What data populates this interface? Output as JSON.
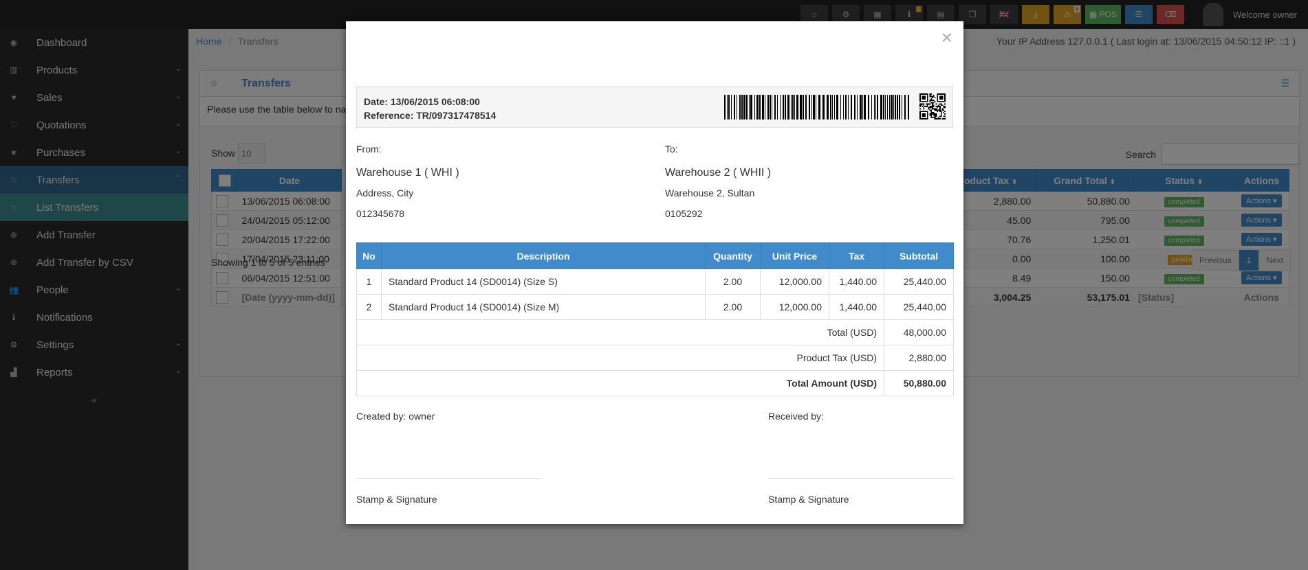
{
  "topbar": {
    "buttons": [
      {
        "name": "dashboard-icon",
        "glyph": "⌂",
        "style": "",
        "badge": ""
      },
      {
        "name": "settings-cogs-icon",
        "glyph": "⚙",
        "style": "",
        "badge": ""
      },
      {
        "name": "calculator-icon",
        "glyph": "▦",
        "style": "",
        "badge": ""
      },
      {
        "name": "info-icon",
        "glyph": "ℹ",
        "style": "",
        "badge": "1"
      },
      {
        "name": "calendar-icon",
        "glyph": "▤",
        "style": "",
        "badge": ""
      },
      {
        "name": "window-icon",
        "glyph": "❐",
        "style": "",
        "badge": ""
      },
      {
        "name": "uk-flag-icon",
        "glyph": "🇬🇧",
        "style": "",
        "badge": ""
      },
      {
        "name": "download-icon",
        "glyph": "⤓",
        "style": "y",
        "badge": ""
      },
      {
        "name": "warning-icon",
        "glyph": "⚠",
        "style": "y",
        "badge": "8"
      },
      {
        "name": "pos-button",
        "glyph": "▦ POS",
        "style": "g",
        "badge": ""
      },
      {
        "name": "list-icon",
        "glyph": "☰",
        "style": "b",
        "badge": ""
      },
      {
        "name": "eraser-icon",
        "glyph": "⌫",
        "style": "r",
        "badge": ""
      }
    ],
    "welcome": "Welcome owner"
  },
  "sidebar": {
    "items": [
      {
        "icon": "dashboard-icon",
        "glyph": "◉",
        "label": "Dashboard",
        "chev": "",
        "state": ""
      },
      {
        "icon": "barcode-icon",
        "glyph": "▥",
        "label": "Products",
        "chev": "⌄",
        "state": ""
      },
      {
        "icon": "heart-icon",
        "glyph": "♥",
        "label": "Sales",
        "chev": "⌄",
        "state": ""
      },
      {
        "icon": "heart-outline-icon",
        "glyph": "♡",
        "label": "Quotations",
        "chev": "⌄",
        "state": ""
      },
      {
        "icon": "star-icon",
        "glyph": "★",
        "label": "Purchases",
        "chev": "⌄",
        "state": ""
      },
      {
        "icon": "star-outline-icon",
        "glyph": "☆",
        "label": "Transfers",
        "chev": "⌃",
        "state": "active"
      },
      {
        "icon": "star-outline-icon",
        "glyph": "☆",
        "label": "List Transfers",
        "chev": "",
        "state": "sub"
      },
      {
        "icon": "plus-circle-icon",
        "glyph": "⊕",
        "label": "Add Transfer",
        "chev": "",
        "state": ""
      },
      {
        "icon": "plus-circle-icon",
        "glyph": "⊕",
        "label": "Add Transfer by CSV",
        "chev": "",
        "state": ""
      },
      {
        "icon": "users-icon",
        "glyph": "👥",
        "label": "People",
        "chev": "⌄",
        "state": ""
      },
      {
        "icon": "info-circle-icon",
        "glyph": "ℹ",
        "label": "Notifications",
        "chev": "",
        "state": ""
      },
      {
        "icon": "cog-icon",
        "glyph": "⚙",
        "label": "Settings",
        "chev": "⌄",
        "state": ""
      },
      {
        "icon": "bar-chart-icon",
        "glyph": "▟",
        "label": "Reports",
        "chev": "⌄",
        "state": ""
      }
    ],
    "collapse_glyph": "«"
  },
  "main": {
    "breadcrumb_home": "Home",
    "breadcrumb_sep": "/",
    "breadcrumb_current": "Transfers",
    "ip_info": "Your IP Address 127.0.0.1 ( Last login at: 13/06/2015 04:50:12 IP: ::1 )",
    "panel_title": "Transfers",
    "intro": "Please use the table below to na",
    "show_label": "Show",
    "show_value": "10",
    "search_label": "Search",
    "left_cols": {
      "date_header": "Date"
    },
    "left_rows": [
      "13/06/2015 06:08:00",
      "24/04/2015 05:12:00",
      "20/04/2015 17:22:00",
      "17/04/2015 23:11:00",
      "06/04/2015 12:51:00"
    ],
    "left_footer": "[Date (yyyy-mm-dd)]",
    "right_headers": {
      "product_tax": "oduct Tax",
      "grand_total": "Grand Total",
      "status": "Status",
      "actions": "Actions"
    },
    "right_rows": [
      {
        "tax": "2,880.00",
        "total": "50,880.00",
        "status": "completed"
      },
      {
        "tax": "45.00",
        "total": "795.00",
        "status": "completed"
      },
      {
        "tax": "70.76",
        "total": "1,250.01",
        "status": "completed"
      },
      {
        "tax": "0.00",
        "total": "100.00",
        "status": "pending"
      },
      {
        "tax": "8.49",
        "total": "150.00",
        "status": "completed"
      }
    ],
    "actions_label": "Actions ▾",
    "right_footer": {
      "tax": "3,004.25",
      "total": "53,175.01",
      "status": "[Status]",
      "actions": "Actions"
    },
    "showing": "Showing 1 to 5 of 5 entries",
    "pager": {
      "prev": "Previous",
      "page": "1",
      "next": "Next"
    }
  },
  "modal": {
    "close": "×",
    "date_line": "Date: 13/06/2015 06:08:00",
    "ref_line": "Reference: TR/097317478514",
    "from": {
      "label": "From:",
      "name": "Warehouse 1 ( WHI )",
      "address": "Address, City",
      "phone": "012345678"
    },
    "to": {
      "label": "To:",
      "name": "Warehouse 2 ( WHII )",
      "address": "Warehouse 2, Sultan",
      "phone": "0105292"
    },
    "headers": {
      "no": "No",
      "desc": "Description",
      "qty": "Quantity",
      "price": "Unit Price",
      "tax": "Tax",
      "sub": "Subtotal"
    },
    "items": [
      {
        "no": "1",
        "desc": "Standard Product 14 (SD0014) (Size S)",
        "qty": "2.00",
        "price": "12,000.00",
        "tax": "1,440.00",
        "sub": "25,440.00"
      },
      {
        "no": "2",
        "desc": "Standard Product 14 (SD0014) (Size M)",
        "qty": "2.00",
        "price": "12,000.00",
        "tax": "1,440.00",
        "sub": "25,440.00"
      }
    ],
    "totals": [
      {
        "label": "Total (USD)",
        "value": "48,000.00",
        "grand": false
      },
      {
        "label": "Product Tax (USD)",
        "value": "2,880.00",
        "grand": false
      },
      {
        "label": "Total Amount (USD)",
        "value": "50,880.00",
        "grand": true
      }
    ],
    "created_by": "Created by: owner",
    "received_by": "Received by:",
    "stamp": "Stamp & Signature"
  }
}
